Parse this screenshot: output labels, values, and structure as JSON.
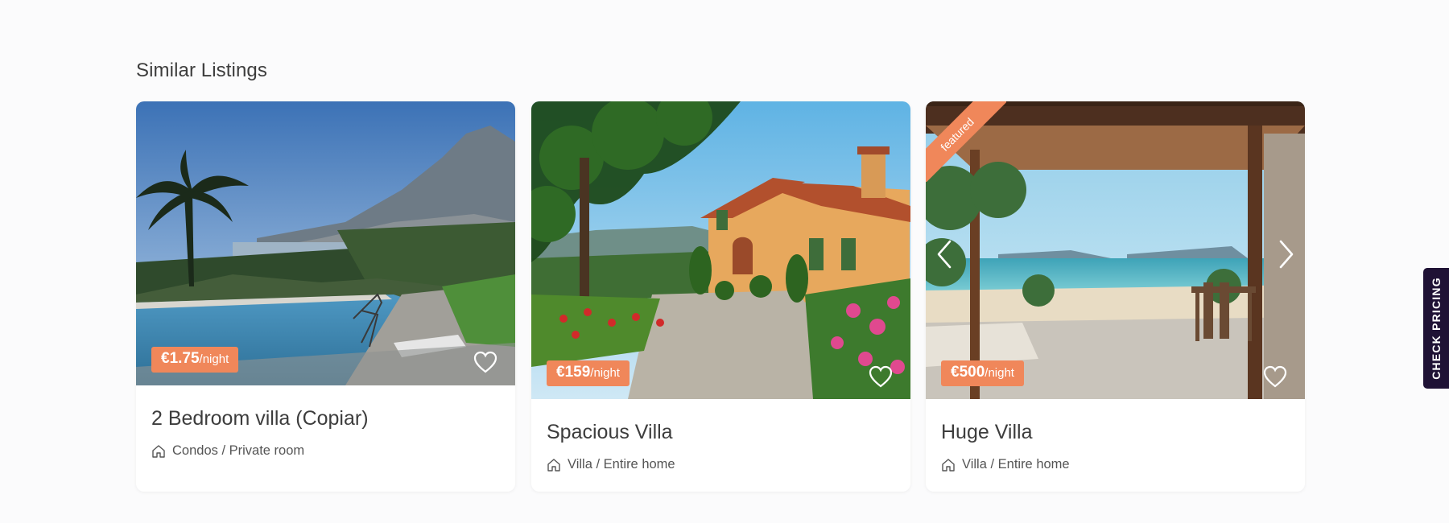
{
  "section": {
    "title": "Similar Listings"
  },
  "listings": [
    {
      "price": "€1.75",
      "unit": "/night",
      "title": "2 Bedroom villa (Copiar)",
      "type": "Condos / Private room",
      "image": "infinity-pool-mountain-view"
    },
    {
      "price": "€159",
      "unit": "/night",
      "title": "Spacious Villa",
      "type": "Villa / Entire home",
      "image": "mediterranean-villa-garden"
    },
    {
      "price": "€500",
      "unit": "/night",
      "title": "Huge Villa",
      "type": "Villa / Entire home",
      "image": "terrace-sea-view",
      "ribbon": "featured"
    }
  ],
  "side_tab": {
    "label": "CHECK PRICING"
  },
  "icons": {
    "favorite": "heart-icon",
    "property_type": "home-icon",
    "prev": "chevron-left-icon",
    "next": "chevron-right-icon"
  },
  "colors": {
    "accent": "#f0875a",
    "side_tab": "#1f1235",
    "background": "#fbfbfc"
  }
}
